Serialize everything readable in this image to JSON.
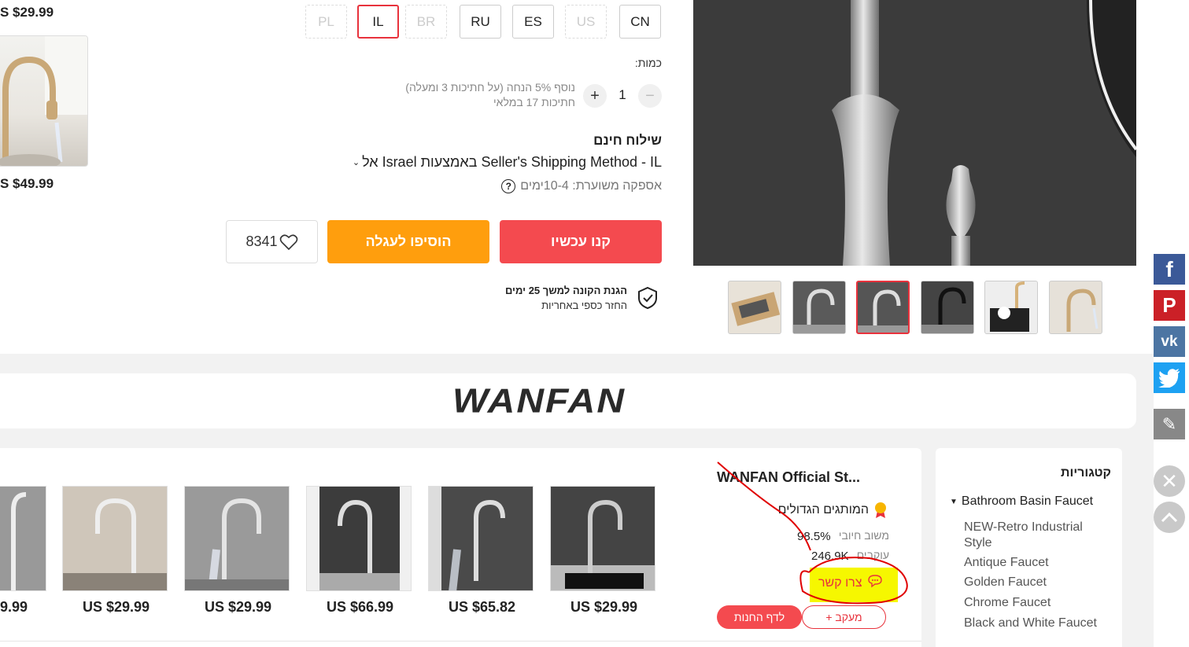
{
  "left_column": {
    "price_top": "S $29.99",
    "price_bottom": "S $49.99"
  },
  "ship_from": {
    "options": [
      {
        "label": "CN",
        "state": "normal"
      },
      {
        "label": "US",
        "state": "disabled"
      },
      {
        "label": "ES",
        "state": "normal"
      },
      {
        "label": "RU",
        "state": "normal"
      },
      {
        "label": "BR",
        "state": "disabled"
      },
      {
        "label": "IL",
        "state": "selected"
      },
      {
        "label": "PL",
        "state": "disabled"
      }
    ]
  },
  "quantity": {
    "label": "כמות:",
    "value": "1",
    "discount_note": "נוסף 5% הנחה (על חתיכות 3 ומעלה)",
    "stock_note": "חתיכות 17 במלאי"
  },
  "shipping": {
    "title": "שילוח חינם",
    "method": "אל Israel באמצעות Seller's Shipping Method - IL",
    "delivery": "אספקה משוערת: 10-4ימים"
  },
  "actions": {
    "buy_now": "קנו עכשיו",
    "add_to_cart": "הוסיפו לעגלה",
    "wishlist_count": "8341"
  },
  "protection": {
    "title": "הגנת הקונה למשך 25 ימים",
    "subtitle": "החזר כספי באחריות"
  },
  "brand": {
    "logo_text": "WANFAN"
  },
  "store": {
    "name": "WANFAN Official St...",
    "badge": "המותגים הגדולים",
    "rating_label": "משוב חיובי",
    "rating_value": "98.5%",
    "followers_label": "עוקבים",
    "followers_value": "246.9K",
    "contact": "צרו קשר",
    "follow": "+ מעקב",
    "store_page": "לדף החנות"
  },
  "products": [
    {
      "price": "US $29.99"
    },
    {
      "price": "US $65.82"
    },
    {
      "price": "US $66.99"
    },
    {
      "price": "US $29.99"
    },
    {
      "price": "US $29.99"
    },
    {
      "price": "9.99"
    }
  ],
  "categories": {
    "title": "קטגוריות",
    "parent": "Bathroom Basin Faucet",
    "items": [
      "NEW-Retro Industrial Style",
      "Antique Faucet",
      "Golden Faucet",
      "Chrome Faucet",
      "Black and White Faucet"
    ]
  },
  "colors": {
    "accent_red": "#f44a4f",
    "accent_orange": "#ff9e0d",
    "selected_border": "#e8323c",
    "facebook": "#3b5998",
    "pinterest": "#cb2027",
    "vk": "#4c75a3",
    "twitter": "#1da1f2",
    "annotation_red": "#e00000",
    "highlight_yellow": "#f6f700"
  }
}
